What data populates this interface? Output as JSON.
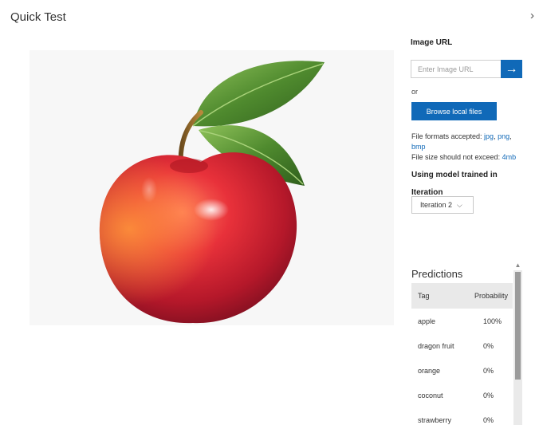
{
  "page": {
    "title": "Quick Test",
    "close_glyph": "›"
  },
  "image_url": {
    "label": "Image URL",
    "placeholder": "Enter Image URL",
    "go_glyph": "→"
  },
  "or_text": "or",
  "browse_label": "Browse local files",
  "formats": {
    "prefix": "File formats accepted: ",
    "jpg": "jpg",
    "sep": ", ",
    "png": "png",
    "comma": ",",
    "bmp": "bmp",
    "size_prefix": "File size should not exceed: ",
    "size_value": "4mb"
  },
  "model": {
    "label": "Using model trained in",
    "iteration_label": "Iteration",
    "iteration_value": "Iteration 2",
    "chevron": "⌵"
  },
  "predictions": {
    "title": "Predictions",
    "headers": {
      "tag": "Tag",
      "probability": "Probability"
    },
    "rows": [
      {
        "tag": "apple",
        "probability": "100%"
      },
      {
        "tag": "dragon fruit",
        "probability": "0%"
      },
      {
        "tag": "orange",
        "probability": "0%"
      },
      {
        "tag": "coconut",
        "probability": "0%"
      },
      {
        "tag": "strawberry",
        "probability": "0%"
      }
    ],
    "scroll_up_glyph": "▲"
  },
  "colors": {
    "accent": "#1069b8",
    "image_bg": "#f7f7f7",
    "header_bg": "#e9e9e9"
  }
}
